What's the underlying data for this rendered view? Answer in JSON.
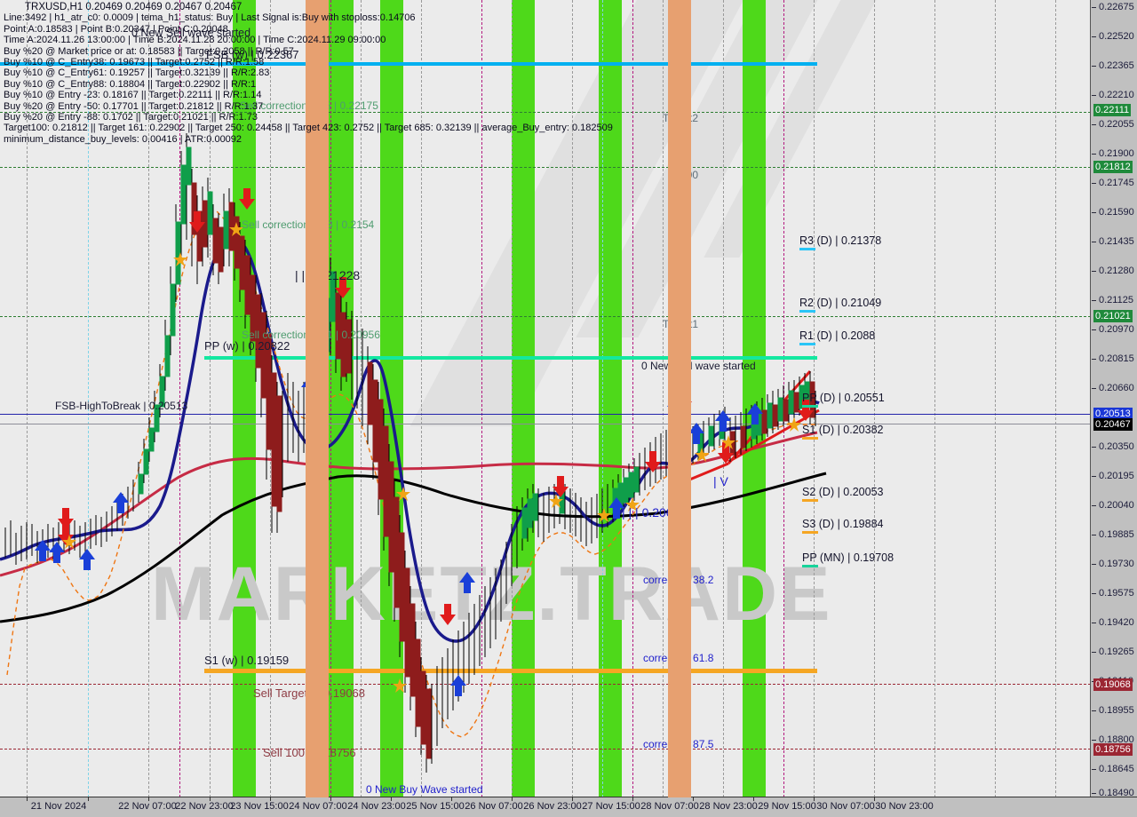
{
  "window": {
    "title": "TRXUSD,H1"
  },
  "header": {
    "symbol_line": "TRXUSD,H1  0.20469 0.20469 0.20467 0.20467",
    "lines": [
      "Line:3492 | h1_atr_c0: 0.0009 | tema_h1_status: Buy | Last Signal is:Buy with stoploss:0.14706",
      "Point A:0.18583 | Point B:0.20347 | Point C:0.20048",
      "Time A:2024.11.26 13:00:00 | Time B:2024.11.28 20:00:00 | Time C:2024.11.29 09:00:00",
      "Buy %20 @ Market price or at: 0.18583 || Target:0.2058 || R/R:0.57",
      "Buy %10 @ C_Entry38: 0.19673 || Target:0.2752 || R/R:1.58",
      "Buy %10 @ C_Entry61: 0.19257 || Target:0.32139 || R/R:2.83",
      "Buy %10 @ C_Entry88: 0.18804 || Target:0.22902 || R/R:1",
      "Buy %10 @ Entry -23: 0.18167 || Target:0.22111 || R/R:1.14",
      "Buy %20 @ Entry -50: 0.17701 || Target:0.21812 || R/R:1.37",
      "Buy %20 @ Entry -88: 0.1702 || Target:0.21021 || R/R:1.73",
      "Target100: 0.21812 || Target 161: 0.22902 || Target 250: 0.24458 || Target 423: 0.2752 || Target 685: 0.32139 || average_Buy_entry: 0.182509",
      "minimum_distance_buy_levels: 0.00416 | ATR:0.00092"
    ]
  },
  "chart_data": {
    "type": "line",
    "title": "TRXUSD,H1",
    "symbol": "TRXUSD",
    "timeframe": "H1",
    "ohlc": {
      "open": 0.20469,
      "high": 0.20469,
      "low": 0.20467,
      "close": 0.20467
    },
    "ylim": [
      0.1849,
      0.22675
    ],
    "xlabel": "",
    "ylabel": "",
    "grid": true,
    "price_ticks": [
      "0.22675",
      "0.22520",
      "0.22365",
      "0.22210",
      "0.22055",
      "0.21900",
      "0.21745",
      "0.21590",
      "0.21435",
      "0.21280",
      "0.21125",
      "0.20970",
      "0.20815",
      "0.20660",
      "0.20350",
      "0.20195",
      "0.20040",
      "0.19885",
      "0.19730",
      "0.19575",
      "0.19420",
      "0.19265",
      "0.19110",
      "0.18955",
      "0.18800",
      "0.18645",
      "0.18490"
    ],
    "price_tags": [
      {
        "value": "0.22111",
        "color": "green"
      },
      {
        "value": "0.21812",
        "color": "green"
      },
      {
        "value": "0.21021",
        "color": "green"
      },
      {
        "value": "0.20513",
        "color": "blue"
      },
      {
        "value": "0.20467",
        "color": "black"
      },
      {
        "value": "0.19068",
        "color": "red"
      },
      {
        "value": "0.18756",
        "color": "red"
      }
    ],
    "time_ticks": [
      "21 Nov 2024",
      "22 Nov 07:00",
      "22 Nov 23:00",
      "23 Nov 15:00",
      "24 Nov 07:00",
      "24 Nov 23:00",
      "25 Nov 15:00",
      "26 Nov 07:00",
      "26 Nov 23:00",
      "27 Nov 15:00",
      "28 Nov 07:00",
      "28 Nov 23:00",
      "29 Nov 15:00",
      "30 Nov 07:00",
      "30 Nov 23:00"
    ]
  },
  "pivots": [
    {
      "label": "R3 (D) | 0.21378",
      "color": "#29c5f6"
    },
    {
      "label": "R2 (D) | 0.21049",
      "color": "#29c5f6"
    },
    {
      "label": "R1 (D) | 0.2088",
      "color": "#29c5f6"
    },
    {
      "label": "PP (D) | 0.20551",
      "color": "#17d39a"
    },
    {
      "label": "S1 (D) | 0.20382",
      "color": "#f5a623"
    },
    {
      "label": "S2 (D) | 0.20053",
      "color": "#f5a623"
    },
    {
      "label": "S3 (D) | 0.19884",
      "color": "#f5a623"
    },
    {
      "label": "PP (MN) | 0.19708",
      "color": "#17d39a"
    }
  ],
  "annotations": {
    "new_sell_wave_top": "0 New Sell wave started",
    "fsb_wk": "FSB (w) | 0.22367",
    "sell_corr_875": "Sell correction 87.5 | 0.22175",
    "sell_corr_618": "Sell correction 61.8 | 0.2154",
    "high_label": "| | | 0.21228",
    "sell_corr_382": "Sell correction 38.1 | 0.20956",
    "pp_w": "PP (w) | 0.20822",
    "fsb_high_to_break": "FSB-HighToBreak | 0.20513",
    "new_sell_wave_right": "0 New Sell wave started",
    "low_label": "| | | 0.20048",
    "v_label": "| V",
    "target1": "Target1",
    "target2": "Target2",
    "hundred": "100",
    "correction_382": "correction 38.2",
    "correction_618": "correction 61.8",
    "correction_875": "correction 87.5",
    "s1_w": "S1 (w) | 0.19159",
    "sell_target1": "Sell Target1 | 0.19068",
    "sell_100": "Sell 100 | 0.18756",
    "new_buy_wave": "0 New Buy Wave started"
  },
  "watermark": {
    "text": "MARKETZ.TRADE"
  },
  "colors": {
    "band_green": "#4ed91a",
    "band_orange": "#e7a070",
    "line_cyan": "#00b0f0",
    "line_springgreen": "#13e8a0",
    "line_orange": "#f5a623",
    "ma_fast": "#1a1a8c",
    "ma_mid": "#c62b45",
    "ma_slow": "#000000",
    "bg": "#ebebeb",
    "scale_bg": "#c0c0c0"
  }
}
